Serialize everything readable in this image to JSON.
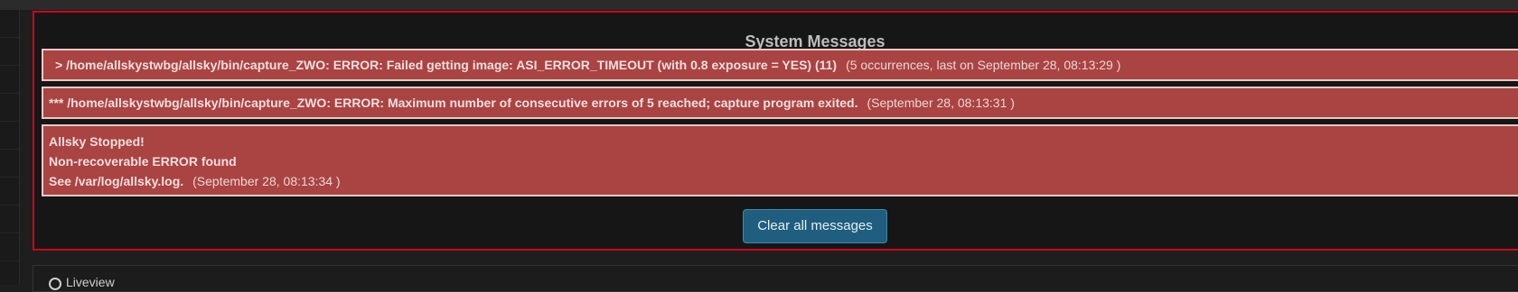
{
  "panel": {
    "title": "System Messages",
    "clear_button": "Clear all messages"
  },
  "messages": [
    {
      "text": "> /home/allskystwbg/allsky/bin/capture_ZWO: ERROR: Failed getting image: ASI_ERROR_TIMEOUT (with 0.8 exposure = YES) (11)",
      "meta": "(5 occurrences, last on September 28, 08:13:29 )"
    },
    {
      "text": "*** /home/allskystwbg/allsky/bin/capture_ZWO: ERROR: Maximum number of consecutive errors of 5 reached; capture program exited.",
      "meta": "(September 28, 08:13:31 )"
    },
    {
      "line1": "Allsky Stopped!",
      "line2": "Non-recoverable ERROR found",
      "line3": "See /var/log/allsky.log.",
      "meta": "(September 28, 08:13:34 )"
    }
  ],
  "liveview": {
    "label": "Liveview"
  },
  "colors": {
    "panel_border": "#d0021b",
    "alert_bg": "#a94442",
    "button_bg": "#1f5e7e"
  }
}
